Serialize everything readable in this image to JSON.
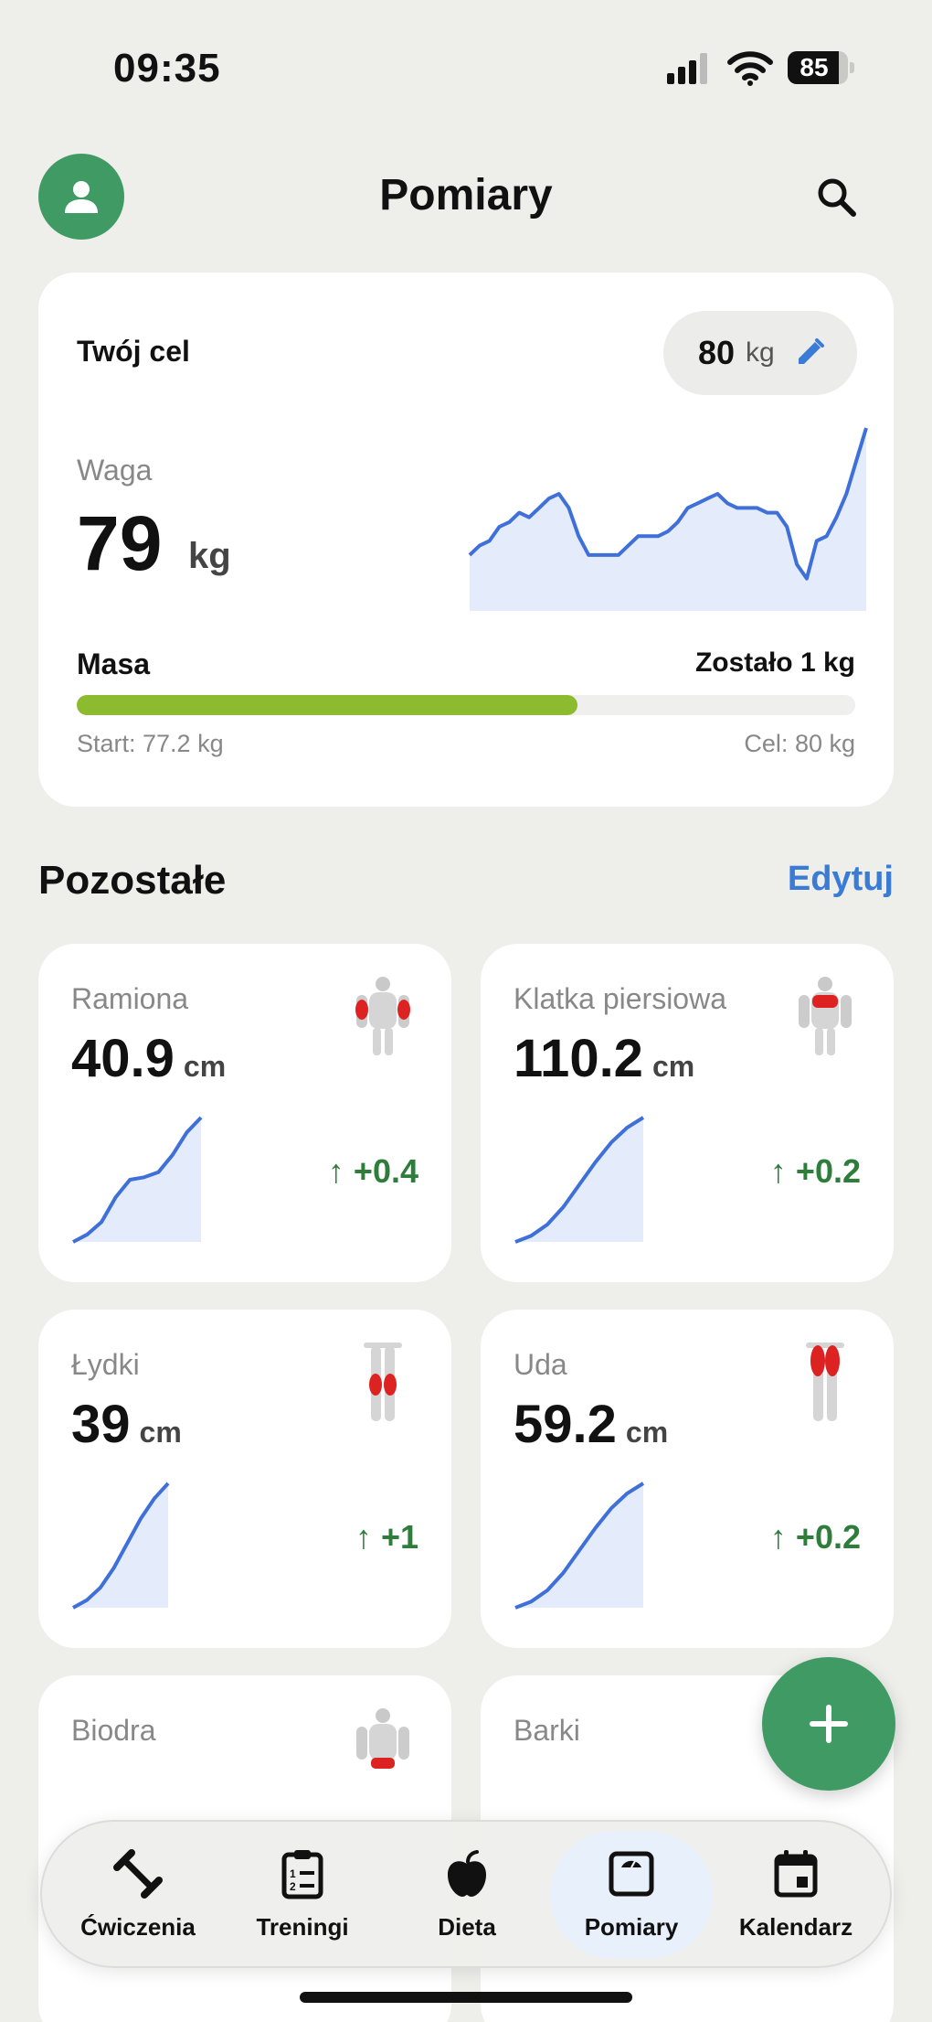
{
  "status": {
    "time": "09:35",
    "battery": "85",
    "battery_level": 0.85
  },
  "header": {
    "title": "Pomiary"
  },
  "goal": {
    "label": "Twój cel",
    "value": "80",
    "unit": "kg",
    "weight_label": "Waga",
    "weight_value": "79",
    "weight_unit": "kg",
    "mass_label": "Masa",
    "remaining": "Zostało 1 kg",
    "start": "Start: 77.2 kg",
    "target": "Cel: 80 kg",
    "progress": 0.643,
    "history": [
      77.6,
      77.8,
      77.9,
      78.2,
      78.3,
      78.5,
      78.4,
      78.6,
      78.8,
      78.9,
      78.6,
      78.0,
      77.6,
      77.6,
      77.6,
      77.6,
      77.8,
      78.0,
      78.0,
      78.0,
      78.1,
      78.3,
      78.6,
      78.7,
      78.8,
      78.9,
      78.7,
      78.6,
      78.6,
      78.6,
      78.5,
      78.5,
      78.2,
      77.4,
      77.1,
      77.9,
      78.0,
      78.4,
      78.9,
      79.6,
      80.3
    ],
    "accent": "#8cbb2f"
  },
  "section": {
    "title": "Pozostałe",
    "edit": "Edytuj"
  },
  "measurements": [
    {
      "name": "Ramiona",
      "value": "40.9",
      "unit": "cm",
      "delta": "+0.4",
      "icon": "arms-muscle-icon",
      "curve": [
        0,
        6,
        16,
        36,
        50,
        52,
        56,
        70,
        88,
        100
      ]
    },
    {
      "name": "Klatka piersiowa",
      "value": "110.2",
      "unit": "cm",
      "delta": "+0.2",
      "icon": "chest-muscle-icon",
      "curve": [
        0,
        5,
        14,
        28,
        46,
        64,
        80,
        92,
        100
      ]
    },
    {
      "name": "Łydki",
      "value": "39",
      "unit": "cm",
      "delta": "+1",
      "icon": "calves-muscle-icon",
      "curve": [
        0,
        6,
        16,
        32,
        52,
        72,
        88,
        100
      ]
    },
    {
      "name": "Uda",
      "value": "59.2",
      "unit": "cm",
      "delta": "+0.2",
      "icon": "thighs-muscle-icon",
      "curve": [
        0,
        5,
        14,
        28,
        46,
        64,
        80,
        92,
        100
      ]
    },
    {
      "name": "Biodra",
      "value": "",
      "unit": "",
      "delta": "",
      "icon": "hips-muscle-icon",
      "curve": []
    },
    {
      "name": "Barki",
      "value": "",
      "unit": "",
      "delta": "",
      "icon": "shoulders-muscle-icon",
      "curve": []
    }
  ],
  "tabs": [
    {
      "label": "Ćwiczenia",
      "icon": "dumbbell-icon"
    },
    {
      "label": "Treningi",
      "icon": "clipboard-list-icon"
    },
    {
      "label": "Dieta",
      "icon": "apple-icon"
    },
    {
      "label": "Pomiary",
      "icon": "scale-icon",
      "active": true
    },
    {
      "label": "Kalendarz",
      "icon": "calendar-icon"
    }
  ],
  "colors": {
    "brand_green": "#3f9a63",
    "chart_line": "#3f6fd8",
    "chart_fill": "#e4ecfb",
    "delta_green": "#2e7d3b",
    "link_blue": "#3a7bd5"
  }
}
